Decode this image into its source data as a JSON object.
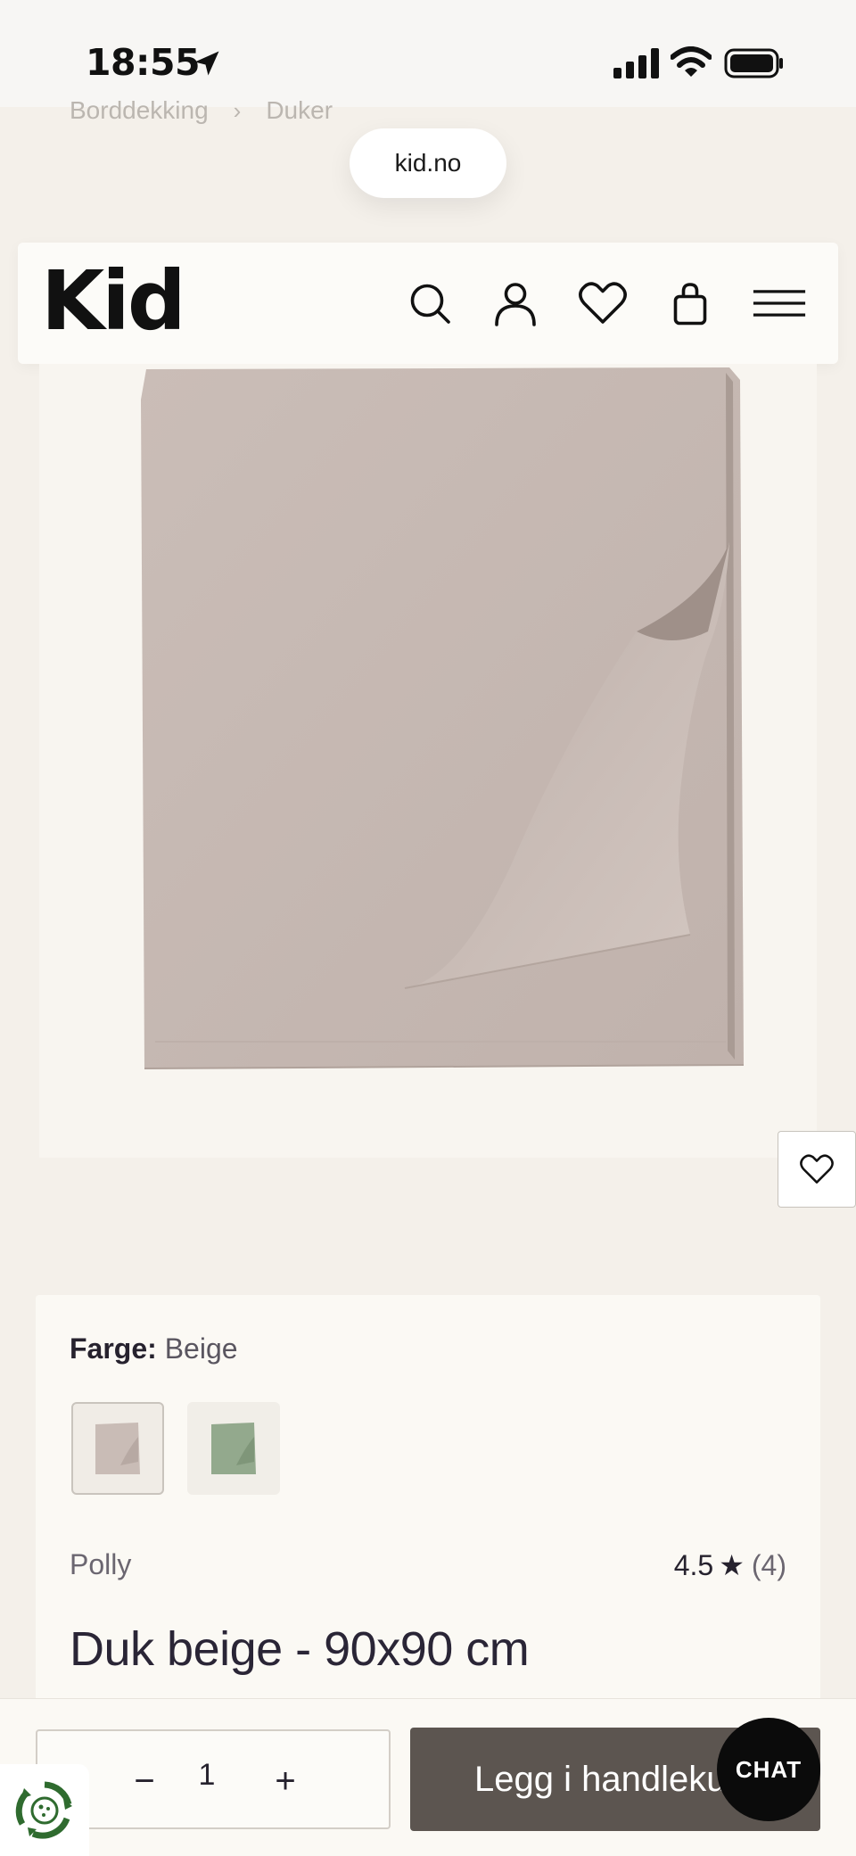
{
  "status_bar": {
    "time": "18:55"
  },
  "breadcrumb": {
    "items": [
      "Borddekking",
      "Duker"
    ],
    "separator": "›"
  },
  "browser": {
    "url": "kid.no"
  },
  "header": {
    "logo": "Kid",
    "icons": [
      "search-icon",
      "account-icon",
      "heart-icon",
      "bag-icon",
      "menu-icon"
    ]
  },
  "product": {
    "color_label": "Farge:",
    "color_value": "Beige",
    "swatches": [
      {
        "name": "Beige",
        "color": "#c9bcb6",
        "selected": true
      },
      {
        "name": "Grønn",
        "color": "#93a98d",
        "selected": false
      }
    ],
    "brand": "Polly",
    "rating_value": "4.5",
    "rating_star": "★",
    "rating_count": "(4)",
    "title": "Duk beige - 90x90 cm",
    "image_color": "#c8bbb5"
  },
  "cart": {
    "quantity": "1",
    "minus_symbol": "−",
    "plus_symbol": "+",
    "add_to_cart_label": "Legg i handlekurv"
  },
  "chat": {
    "label": "CHAT"
  },
  "colors": {
    "page_background": "#f4f0ea",
    "card_background": "#fbf9f4",
    "button_dark": "#5c5550",
    "text_primary": "#26222e"
  }
}
